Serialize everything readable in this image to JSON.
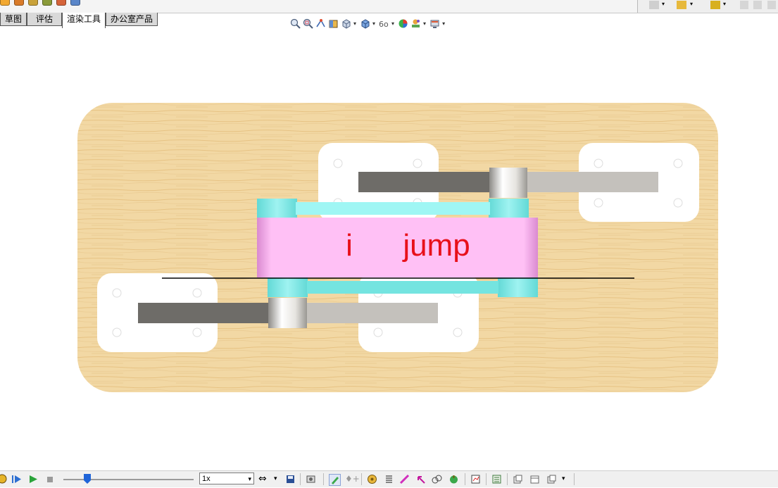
{
  "tabs": [
    {
      "label": "草图",
      "active": false
    },
    {
      "label": "评估",
      "active": false
    },
    {
      "label": "渲染工具",
      "active": true
    },
    {
      "label": "办公室产品",
      "active": false
    }
  ],
  "model": {
    "label_i": "i",
    "label_jump": "jump",
    "label_color": "#e8101a",
    "band_color": "#ffc0f5",
    "ring_color": "#7fe9e6",
    "board_color": "#f2d8a4"
  },
  "motion": {
    "speed_value": "1x"
  },
  "icons": {
    "view": [
      "zoom-to-fit-icon",
      "zoom-area-icon",
      "previous-view-icon",
      "section-view-icon",
      "view-orientation-icon",
      "display-style-icon",
      "hide-show-icon",
      "edit-appearance-icon",
      "apply-scene-icon",
      "view-settings-icon"
    ]
  }
}
